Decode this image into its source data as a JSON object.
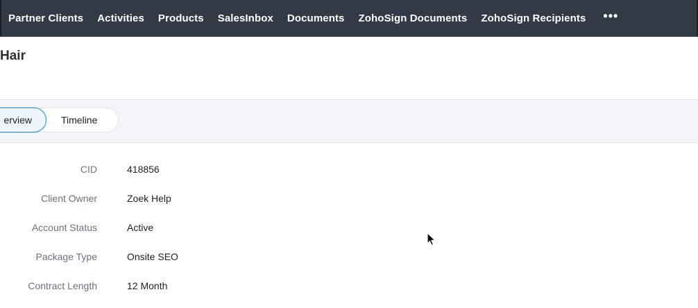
{
  "topnav": {
    "items": [
      {
        "label": "Partner Clients"
      },
      {
        "label": "Activities"
      },
      {
        "label": "Products"
      },
      {
        "label": "SalesInbox"
      },
      {
        "label": "Documents"
      },
      {
        "label": "ZohoSign Documents"
      },
      {
        "label": "ZohoSign Recipients"
      }
    ],
    "more_label": "•••"
  },
  "record": {
    "title": "Hair"
  },
  "tabs": {
    "overview_label": "erview",
    "timeline_label": "Timeline"
  },
  "fields": [
    {
      "label": "CID",
      "value": "418856"
    },
    {
      "label": "Client Owner",
      "value": "Zoek Help"
    },
    {
      "label": "Account Status",
      "value": "Active"
    },
    {
      "label": "Package Type",
      "value": "Onsite SEO"
    },
    {
      "label": "Contract Length",
      "value": "12 Month"
    }
  ],
  "colors": {
    "nav_bg": "#333a46",
    "tab_active_border": "#2d8fd0",
    "tab_band_bg": "#f3f5f8"
  }
}
